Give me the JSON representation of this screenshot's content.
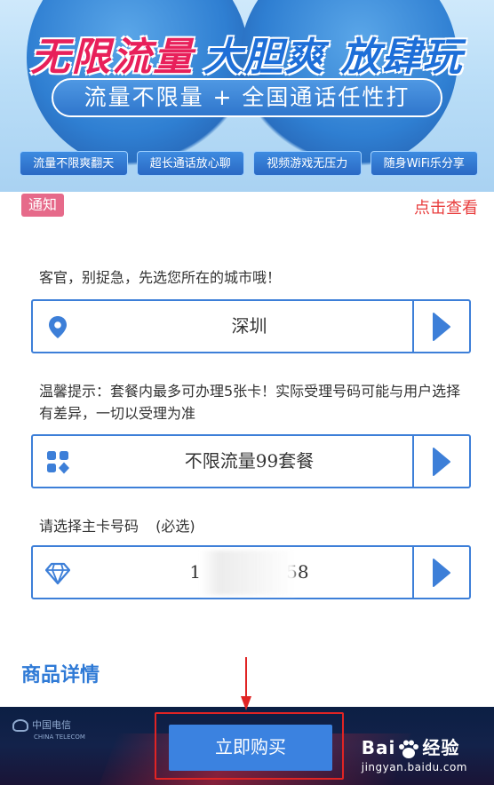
{
  "banner": {
    "headline_left": "无限流量",
    "headline_right": "大胆爽 放肆玩",
    "slogan": "流量不限量 + 全国通话任性打",
    "tags": [
      "流量不限爽翻天",
      "超长通话放心聊",
      "视频游戏无压力",
      "随身WiFi乐分享"
    ]
  },
  "notice": {
    "badge": "通知",
    "link": "点击查看"
  },
  "form": {
    "city_prompt": "客官，别捉急，先选您所在的城市哦！",
    "city_value": "深圳",
    "tip": "温馨提示：套餐内最多可办理5张卡！实际受理号码可能与用户选择有差异，一切以受理为准",
    "plan_value": "不限流量99套餐",
    "number_prompt": "请选择主卡号码",
    "number_required": "(必选)",
    "number_start": "1",
    "number_end": "58"
  },
  "details_title": "商品详情",
  "bottom": {
    "brand_line1": "中国电信",
    "brand_line2": "CHINA TELECOM",
    "buy_label": "立即购买"
  },
  "watermark": {
    "main_left": "Bai",
    "main_right": "经验",
    "sub": "jingyan.baidu.com"
  },
  "icons": {
    "city": "location-pin-icon",
    "plan": "grid-icon",
    "number": "diamond-icon",
    "arrow": "play-right-icon"
  },
  "colors": {
    "accent": "#3d7fd8",
    "notice_badge": "#e66a8a",
    "notice_link": "#e83c3c",
    "buy_button": "#3b82e0",
    "highlight": "#e02424"
  }
}
